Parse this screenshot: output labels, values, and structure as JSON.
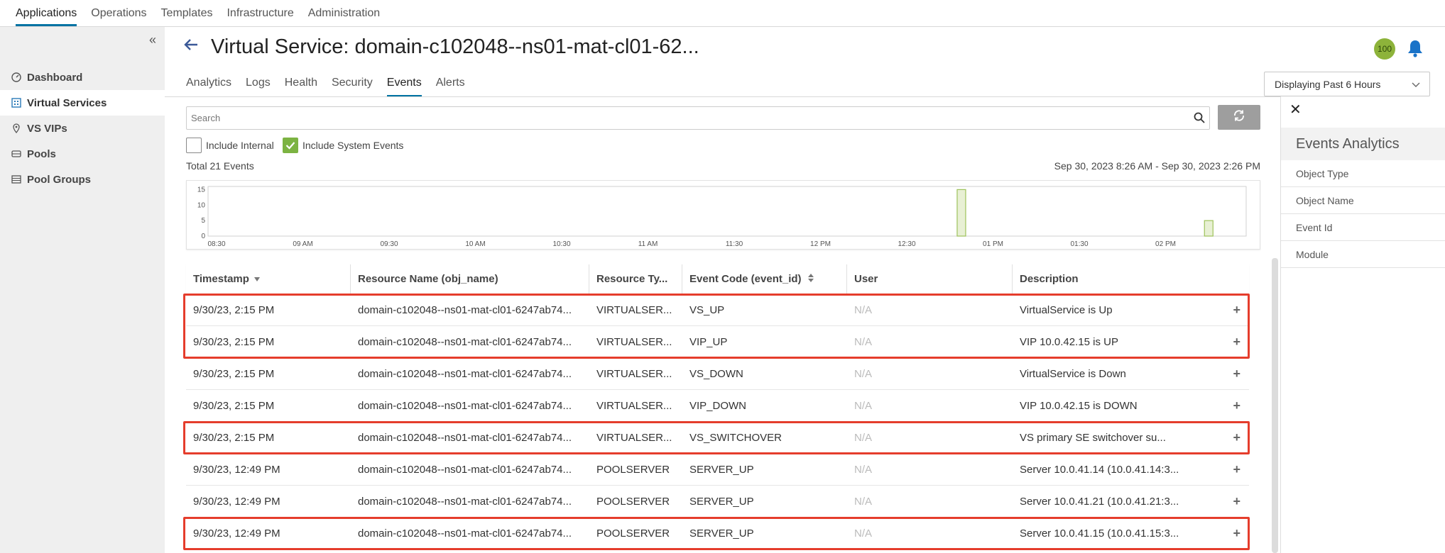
{
  "topnav": {
    "tabs": [
      "Applications",
      "Operations",
      "Templates",
      "Infrastructure",
      "Administration"
    ],
    "active_index": 0
  },
  "sidebar": {
    "items": [
      {
        "label": "Dashboard",
        "icon": "dashboard-icon"
      },
      {
        "label": "Virtual Services",
        "icon": "virtual-services-icon",
        "active": true
      },
      {
        "label": "VS VIPs",
        "icon": "location-pin-icon"
      },
      {
        "label": "Pools",
        "icon": "pool-icon"
      },
      {
        "label": "Pool Groups",
        "icon": "pool-groups-icon"
      }
    ]
  },
  "header": {
    "title": "Virtual Service:  domain-c102048--ns01-mat-cl01-62...",
    "health_score": "100",
    "health_color": "#8db33a"
  },
  "subtabs": {
    "items": [
      "Analytics",
      "Logs",
      "Health",
      "Security",
      "Events",
      "Alerts"
    ],
    "active_index": 4
  },
  "time_range": {
    "label": "Displaying Past 6 Hours"
  },
  "search": {
    "placeholder": "Search"
  },
  "filters": {
    "include_internal": {
      "label": "Include Internal",
      "checked": false
    },
    "include_system_events": {
      "label": "Include System Events",
      "checked": true
    }
  },
  "summary": {
    "total": "Total 21 Events",
    "range": "Sep 30, 2023 8:26 AM - Sep 30, 2023 2:26 PM"
  },
  "chart_data": {
    "type": "bar",
    "y_ticks": [
      "15",
      "10",
      "5",
      "0"
    ],
    "ylim": [
      0,
      16
    ],
    "x_ticks": [
      "08:30",
      "09 AM",
      "09:30",
      "10 AM",
      "10:30",
      "11 AM",
      "11:30",
      "12 PM",
      "12:30",
      "01 PM",
      "01:30",
      "02 PM"
    ],
    "bars": [
      {
        "time": "12:49 PM",
        "value": 15
      },
      {
        "time": "2:15 PM",
        "value": 5
      }
    ],
    "bar_color": "#e8f0d4",
    "bar_border": "#9dc25a"
  },
  "table": {
    "columns": [
      "Timestamp",
      "Resource Name (obj_name)",
      "Resource Ty...",
      "Event Code (event_id)",
      "User",
      "Description"
    ],
    "rows": [
      {
        "ts": "9/30/23, 2:15 PM",
        "name": "domain-c102048--ns01-mat-cl01-6247ab74...",
        "type": "VIRTUALSER...",
        "code": "VS_UP",
        "user": "N/A",
        "desc": "VirtualService is Up",
        "highlight": true
      },
      {
        "ts": "9/30/23, 2:15 PM",
        "name": "domain-c102048--ns01-mat-cl01-6247ab74...",
        "type": "VIRTUALSER...",
        "code": "VIP_UP",
        "user": "N/A",
        "desc": "VIP 10.0.42.15 is UP",
        "highlight": true
      },
      {
        "ts": "9/30/23, 2:15 PM",
        "name": "domain-c102048--ns01-mat-cl01-6247ab74...",
        "type": "VIRTUALSER...",
        "code": "VS_DOWN",
        "user": "N/A",
        "desc": "VirtualService is Down",
        "highlight": false
      },
      {
        "ts": "9/30/23, 2:15 PM",
        "name": "domain-c102048--ns01-mat-cl01-6247ab74...",
        "type": "VIRTUALSER...",
        "code": "VIP_DOWN",
        "user": "N/A",
        "desc": "VIP 10.0.42.15 is DOWN",
        "highlight": false
      },
      {
        "ts": "9/30/23, 2:15 PM",
        "name": "domain-c102048--ns01-mat-cl01-6247ab74...",
        "type": "VIRTUALSER...",
        "code": "VS_SWITCHOVER",
        "user": "N/A",
        "desc": "VS primary SE switchover su...",
        "highlight": true
      },
      {
        "ts": "9/30/23, 12:49 PM",
        "name": "domain-c102048--ns01-mat-cl01-6247ab74...",
        "type": "POOLSERVER",
        "code": "SERVER_UP",
        "user": "N/A",
        "desc": "Server 10.0.41.14 (10.0.41.14:3...",
        "highlight": false
      },
      {
        "ts": "9/30/23, 12:49 PM",
        "name": "domain-c102048--ns01-mat-cl01-6247ab74...",
        "type": "POOLSERVER",
        "code": "SERVER_UP",
        "user": "N/A",
        "desc": "Server 10.0.41.21 (10.0.41.21:3...",
        "highlight": false
      },
      {
        "ts": "9/30/23, 12:49 PM",
        "name": "domain-c102048--ns01-mat-cl01-6247ab74...",
        "type": "POOLSERVER",
        "code": "SERVER_UP",
        "user": "N/A",
        "desc": "Server 10.0.41.15 (10.0.41.15:3...",
        "highlight": true
      }
    ],
    "highlight_color": "#e53d2c"
  },
  "right_panel": {
    "title": "Events Analytics",
    "items": [
      "Object Type",
      "Object Name",
      "Event Id",
      "Module"
    ]
  }
}
